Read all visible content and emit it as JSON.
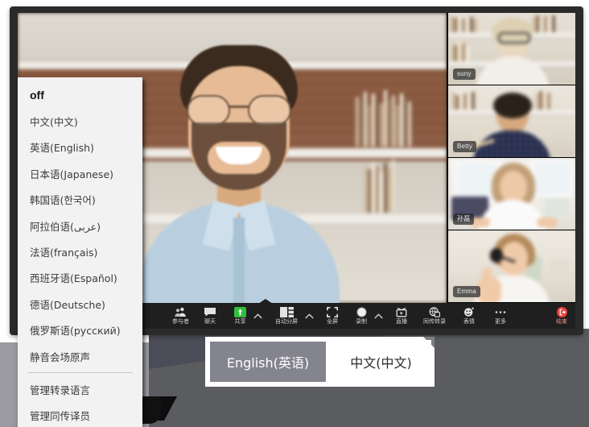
{
  "app": {
    "name": "video-conference-client",
    "colors": {
      "toolbar_bg": "#1f1f1f",
      "share_green": "#2fbf3a",
      "end_red": "#e8413c",
      "selected_lang_bg": "#84848f",
      "menu_bg": "#f2f2f2",
      "bg_light": "#9a9ba1",
      "bg_dark": "#5b5c60",
      "bg_purple": "#4c4c58"
    }
  },
  "interpretation_menu": {
    "items": [
      {
        "label": "off",
        "emphasis": true
      },
      {
        "label": "中文(中文)",
        "emphasis": false
      },
      {
        "label": "英语(English)",
        "emphasis": false
      },
      {
        "label": "日本语(Japanese)",
        "emphasis": false
      },
      {
        "label": "韩国语(한국어)",
        "emphasis": false
      },
      {
        "label": "阿拉伯语(عربى)",
        "emphasis": false
      },
      {
        "label": "法语(français)",
        "emphasis": false
      },
      {
        "label": "西班牙语(Español)",
        "emphasis": false
      },
      {
        "label": "德语(Deutsche)",
        "emphasis": false
      },
      {
        "label": "俄罗斯语(русский)",
        "emphasis": false
      },
      {
        "label": "静音会场原声",
        "emphasis": false
      }
    ],
    "footer_items": [
      {
        "label": "管理转录语言"
      },
      {
        "label": "管理同传译员"
      }
    ]
  },
  "toolbar": {
    "items": [
      {
        "label": "参与者",
        "icon": "participants-icon",
        "caret": false
      },
      {
        "label": "聊天",
        "icon": "chat-icon",
        "caret": false
      },
      {
        "label": "共享",
        "icon": "share-screen-icon",
        "caret": true
      },
      {
        "label": "自动分屏",
        "icon": "split-view-icon",
        "caret": true
      },
      {
        "label": "全屏",
        "icon": "fullscreen-icon",
        "caret": false
      },
      {
        "label": "录制",
        "icon": "record-icon",
        "caret": true
      },
      {
        "label": "直播",
        "icon": "live-stream-icon",
        "caret": false
      },
      {
        "label": "同传转录",
        "icon": "interpretation-icon",
        "caret": false
      },
      {
        "label": "表情",
        "icon": "reaction-icon",
        "caret": false
      },
      {
        "label": "更多",
        "icon": "more-icon",
        "caret": false
      }
    ],
    "end_button": {
      "label": "结束",
      "icon": "leave-meeting-icon"
    }
  },
  "language_bar": {
    "selected": "English(英语)",
    "alternate": "中文(中文)"
  },
  "participants": {
    "thumbnails": [
      {
        "name": "suny"
      },
      {
        "name": "Betty"
      },
      {
        "name": "孙磊"
      },
      {
        "name": "Emma"
      }
    ]
  }
}
